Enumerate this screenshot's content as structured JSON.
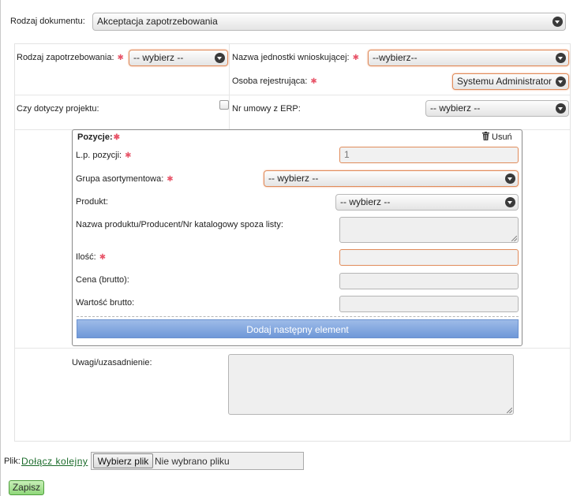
{
  "doc_type": {
    "label": "Rodzaj dokumentu:",
    "value": "Akceptacja zapotrzebowania"
  },
  "req_type": {
    "label": "Rodzaj zapotrzebowania:",
    "value": "-- wybierz --"
  },
  "unit": {
    "label": "Nazwa jednostki wnioskującej:",
    "value": "--wybierz--"
  },
  "registrar": {
    "label": "Osoba rejestrująca:",
    "value": "Systemu Administrator"
  },
  "project": {
    "label": "Czy dotyczy projektu:"
  },
  "erp": {
    "label": "Nr umowy z ERP:",
    "value": "-- wybierz --"
  },
  "positions": {
    "title": "Pozycje:",
    "delete_label": "Usuń",
    "lp": {
      "label": "L.p. pozycji:",
      "value": "1"
    },
    "group": {
      "label": "Grupa asortymentowa:",
      "value": "-- wybierz --"
    },
    "product": {
      "label": "Produkt:",
      "value": "-- wybierz --"
    },
    "name_label": "Nazwa produktu/Producent/Nr katalogowy spoza listy:",
    "qty_label": "Ilość:",
    "price_label": "Cena (brutto):",
    "total_label": "Wartość brutto:",
    "add_button": "Dodaj następny element"
  },
  "remarks_label": "Uwagi/uzasadnienie:",
  "file": {
    "label": "Plik:",
    "link": "Dołącz kolejny",
    "button": "Wybierz plik",
    "status": "Nie wybrano pliku"
  },
  "save_button": "Zapisz"
}
